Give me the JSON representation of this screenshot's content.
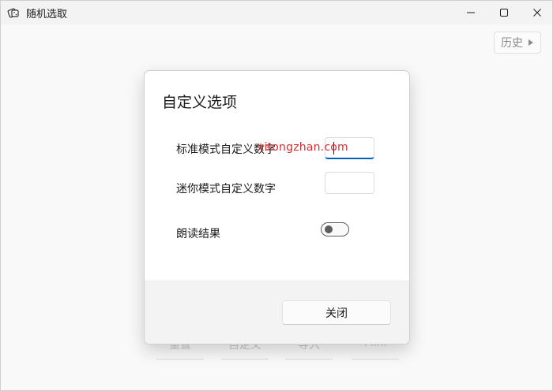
{
  "window": {
    "title": "随机选取"
  },
  "toolbar": {
    "history_label": "历史"
  },
  "bottom_bar": {
    "buttons": [
      "重置",
      "自定义",
      "导入",
      "Mini"
    ]
  },
  "dialog": {
    "title": "自定义选项",
    "rows": [
      {
        "label": "标准模式自定义数字",
        "value": ""
      },
      {
        "label": "迷你模式自定义数字",
        "value": ""
      },
      {
        "label": "朗读结果",
        "toggle_on": false
      }
    ],
    "close_label": "关闭"
  },
  "watermark": "xitongzhan.com",
  "colors": {
    "accent": "#005fb8",
    "watermark": "#d32f2f"
  }
}
